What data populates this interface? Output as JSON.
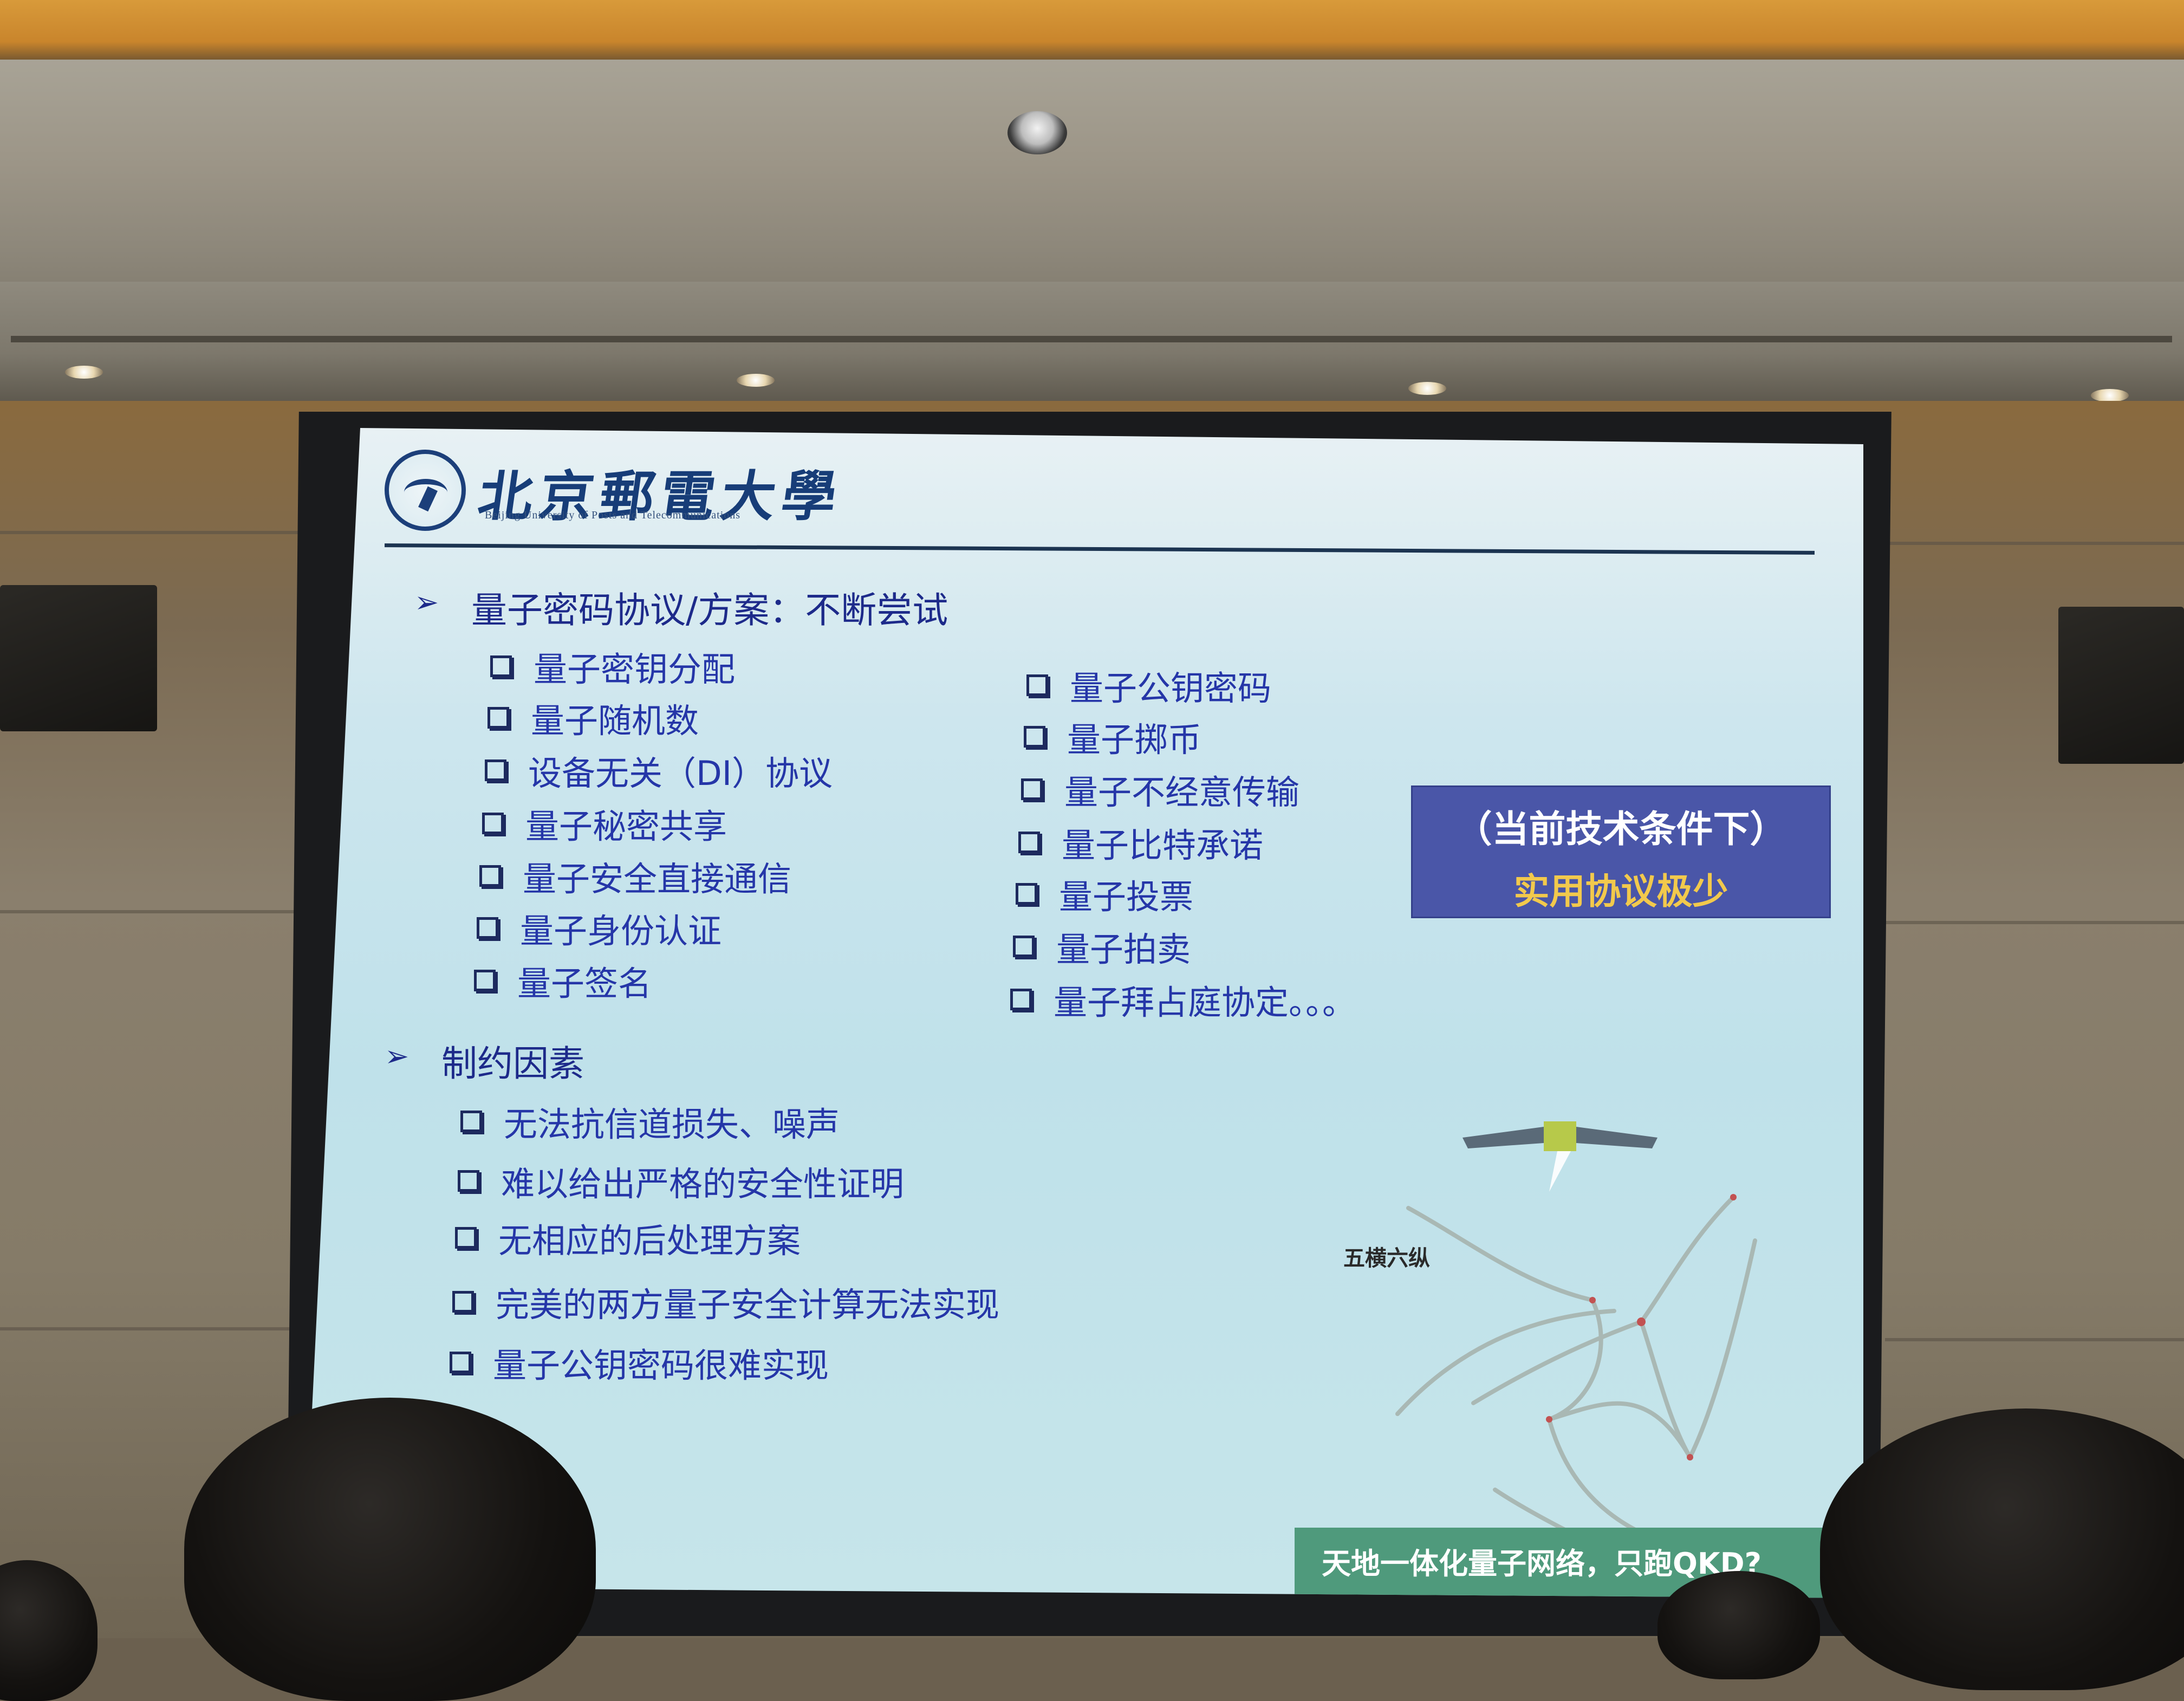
{
  "slide": {
    "university_name": "北京郵電大學",
    "university_subtitle": "Beijing University of Posts and Telecommunications",
    "section1": {
      "heading": "量子密码协议/方案：不断尝试",
      "left_items": [
        "量子密钥分配",
        "量子随机数",
        "设备无关（DI）协议",
        "量子秘密共享",
        "量子安全直接通信",
        "量子身份认证",
        "量子签名"
      ],
      "right_items": [
        "量子公钥密码",
        "量子掷币",
        "量子不经意传输",
        "量子比特承诺",
        "量子投票",
        "量子拍卖",
        "量子拜占庭协定。。。"
      ]
    },
    "callout": {
      "line1": "（当前技术条件下）",
      "line2": "实用协议极少"
    },
    "section2": {
      "heading": "制约因素",
      "items": [
        "无法抗信道损失、噪声",
        "难以给出严格的安全性证明",
        "无相应的后处理方案",
        "完美的两方量子安全计算无法实现",
        "量子公钥密码很难实现"
      ]
    },
    "map": {
      "label": "五横六纵",
      "caption": "天地一体化量子网络，只跑QKD?"
    },
    "colors": {
      "heading": "#1d2a8a",
      "item_text": "#2536a8",
      "callout_bg": "#4a56a8",
      "callout_highlight": "#f2c94c",
      "caption_bg": "#4f9a7c"
    }
  }
}
